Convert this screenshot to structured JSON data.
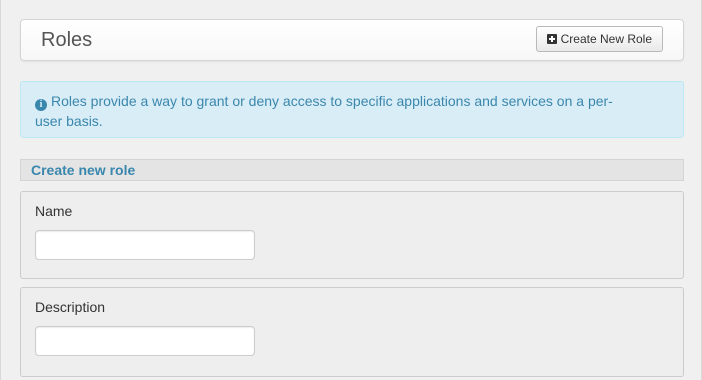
{
  "header": {
    "title": "Roles",
    "create_button_label": "Create New Role",
    "create_button_icon": "plus-square-icon"
  },
  "info_alert": {
    "icon": "info-circle-icon",
    "text": "Roles provide a way to grant or deny access to specific applications and services on a per-user basis."
  },
  "form": {
    "heading": "Create new role",
    "name_label": "Name",
    "name_value": "",
    "description_label": "Description",
    "description_value": ""
  },
  "colors": {
    "accent": "#3a87ad",
    "alert_background": "#d9edf7",
    "page_background": "#f0f0f0"
  }
}
